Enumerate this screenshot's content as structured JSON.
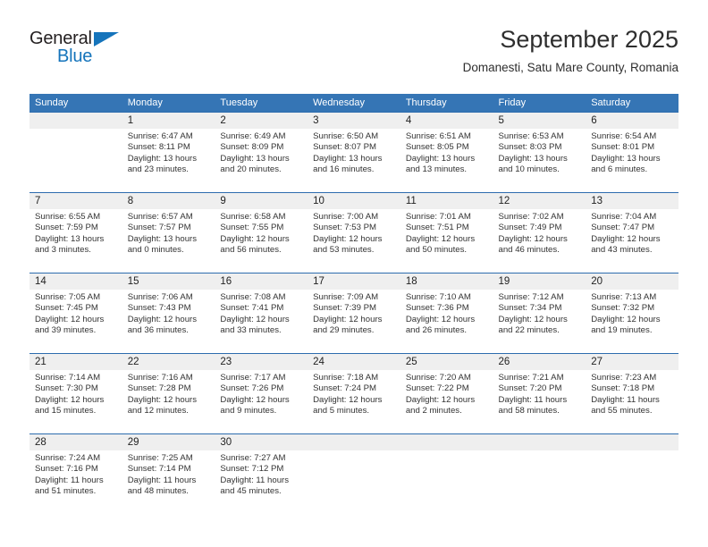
{
  "brand": {
    "name_part1": "General",
    "name_part2": "Blue",
    "color_dark": "#231f20",
    "color_blue": "#1574BB"
  },
  "header": {
    "title": "September 2025",
    "subtitle": "Domanesti, Satu Mare County, Romania"
  },
  "theme": {
    "header_blue": "#3575B5",
    "separator_blue": "#2D6CAE",
    "daynum_band": "#EFEFEF"
  },
  "weekdays": [
    "Sunday",
    "Monday",
    "Tuesday",
    "Wednesday",
    "Thursday",
    "Friday",
    "Saturday"
  ],
  "weeks": [
    [
      {
        "day": "",
        "sunrise": "",
        "sunset": "",
        "daylight_1": "",
        "daylight_2": ""
      },
      {
        "day": "1",
        "sunrise": "Sunrise: 6:47 AM",
        "sunset": "Sunset: 8:11 PM",
        "daylight_1": "Daylight: 13 hours",
        "daylight_2": "and 23 minutes."
      },
      {
        "day": "2",
        "sunrise": "Sunrise: 6:49 AM",
        "sunset": "Sunset: 8:09 PM",
        "daylight_1": "Daylight: 13 hours",
        "daylight_2": "and 20 minutes."
      },
      {
        "day": "3",
        "sunrise": "Sunrise: 6:50 AM",
        "sunset": "Sunset: 8:07 PM",
        "daylight_1": "Daylight: 13 hours",
        "daylight_2": "and 16 minutes."
      },
      {
        "day": "4",
        "sunrise": "Sunrise: 6:51 AM",
        "sunset": "Sunset: 8:05 PM",
        "daylight_1": "Daylight: 13 hours",
        "daylight_2": "and 13 minutes."
      },
      {
        "day": "5",
        "sunrise": "Sunrise: 6:53 AM",
        "sunset": "Sunset: 8:03 PM",
        "daylight_1": "Daylight: 13 hours",
        "daylight_2": "and 10 minutes."
      },
      {
        "day": "6",
        "sunrise": "Sunrise: 6:54 AM",
        "sunset": "Sunset: 8:01 PM",
        "daylight_1": "Daylight: 13 hours",
        "daylight_2": "and 6 minutes."
      }
    ],
    [
      {
        "day": "7",
        "sunrise": "Sunrise: 6:55 AM",
        "sunset": "Sunset: 7:59 PM",
        "daylight_1": "Daylight: 13 hours",
        "daylight_2": "and 3 minutes."
      },
      {
        "day": "8",
        "sunrise": "Sunrise: 6:57 AM",
        "sunset": "Sunset: 7:57 PM",
        "daylight_1": "Daylight: 13 hours",
        "daylight_2": "and 0 minutes."
      },
      {
        "day": "9",
        "sunrise": "Sunrise: 6:58 AM",
        "sunset": "Sunset: 7:55 PM",
        "daylight_1": "Daylight: 12 hours",
        "daylight_2": "and 56 minutes."
      },
      {
        "day": "10",
        "sunrise": "Sunrise: 7:00 AM",
        "sunset": "Sunset: 7:53 PM",
        "daylight_1": "Daylight: 12 hours",
        "daylight_2": "and 53 minutes."
      },
      {
        "day": "11",
        "sunrise": "Sunrise: 7:01 AM",
        "sunset": "Sunset: 7:51 PM",
        "daylight_1": "Daylight: 12 hours",
        "daylight_2": "and 50 minutes."
      },
      {
        "day": "12",
        "sunrise": "Sunrise: 7:02 AM",
        "sunset": "Sunset: 7:49 PM",
        "daylight_1": "Daylight: 12 hours",
        "daylight_2": "and 46 minutes."
      },
      {
        "day": "13",
        "sunrise": "Sunrise: 7:04 AM",
        "sunset": "Sunset: 7:47 PM",
        "daylight_1": "Daylight: 12 hours",
        "daylight_2": "and 43 minutes."
      }
    ],
    [
      {
        "day": "14",
        "sunrise": "Sunrise: 7:05 AM",
        "sunset": "Sunset: 7:45 PM",
        "daylight_1": "Daylight: 12 hours",
        "daylight_2": "and 39 minutes."
      },
      {
        "day": "15",
        "sunrise": "Sunrise: 7:06 AM",
        "sunset": "Sunset: 7:43 PM",
        "daylight_1": "Daylight: 12 hours",
        "daylight_2": "and 36 minutes."
      },
      {
        "day": "16",
        "sunrise": "Sunrise: 7:08 AM",
        "sunset": "Sunset: 7:41 PM",
        "daylight_1": "Daylight: 12 hours",
        "daylight_2": "and 33 minutes."
      },
      {
        "day": "17",
        "sunrise": "Sunrise: 7:09 AM",
        "sunset": "Sunset: 7:39 PM",
        "daylight_1": "Daylight: 12 hours",
        "daylight_2": "and 29 minutes."
      },
      {
        "day": "18",
        "sunrise": "Sunrise: 7:10 AM",
        "sunset": "Sunset: 7:36 PM",
        "daylight_1": "Daylight: 12 hours",
        "daylight_2": "and 26 minutes."
      },
      {
        "day": "19",
        "sunrise": "Sunrise: 7:12 AM",
        "sunset": "Sunset: 7:34 PM",
        "daylight_1": "Daylight: 12 hours",
        "daylight_2": "and 22 minutes."
      },
      {
        "day": "20",
        "sunrise": "Sunrise: 7:13 AM",
        "sunset": "Sunset: 7:32 PM",
        "daylight_1": "Daylight: 12 hours",
        "daylight_2": "and 19 minutes."
      }
    ],
    [
      {
        "day": "21",
        "sunrise": "Sunrise: 7:14 AM",
        "sunset": "Sunset: 7:30 PM",
        "daylight_1": "Daylight: 12 hours",
        "daylight_2": "and 15 minutes."
      },
      {
        "day": "22",
        "sunrise": "Sunrise: 7:16 AM",
        "sunset": "Sunset: 7:28 PM",
        "daylight_1": "Daylight: 12 hours",
        "daylight_2": "and 12 minutes."
      },
      {
        "day": "23",
        "sunrise": "Sunrise: 7:17 AM",
        "sunset": "Sunset: 7:26 PM",
        "daylight_1": "Daylight: 12 hours",
        "daylight_2": "and 9 minutes."
      },
      {
        "day": "24",
        "sunrise": "Sunrise: 7:18 AM",
        "sunset": "Sunset: 7:24 PM",
        "daylight_1": "Daylight: 12 hours",
        "daylight_2": "and 5 minutes."
      },
      {
        "day": "25",
        "sunrise": "Sunrise: 7:20 AM",
        "sunset": "Sunset: 7:22 PM",
        "daylight_1": "Daylight: 12 hours",
        "daylight_2": "and 2 minutes."
      },
      {
        "day": "26",
        "sunrise": "Sunrise: 7:21 AM",
        "sunset": "Sunset: 7:20 PM",
        "daylight_1": "Daylight: 11 hours",
        "daylight_2": "and 58 minutes."
      },
      {
        "day": "27",
        "sunrise": "Sunrise: 7:23 AM",
        "sunset": "Sunset: 7:18 PM",
        "daylight_1": "Daylight: 11 hours",
        "daylight_2": "and 55 minutes."
      }
    ],
    [
      {
        "day": "28",
        "sunrise": "Sunrise: 7:24 AM",
        "sunset": "Sunset: 7:16 PM",
        "daylight_1": "Daylight: 11 hours",
        "daylight_2": "and 51 minutes."
      },
      {
        "day": "29",
        "sunrise": "Sunrise: 7:25 AM",
        "sunset": "Sunset: 7:14 PM",
        "daylight_1": "Daylight: 11 hours",
        "daylight_2": "and 48 minutes."
      },
      {
        "day": "30",
        "sunrise": "Sunrise: 7:27 AM",
        "sunset": "Sunset: 7:12 PM",
        "daylight_1": "Daylight: 11 hours",
        "daylight_2": "and 45 minutes."
      },
      {
        "day": "",
        "sunrise": "",
        "sunset": "",
        "daylight_1": "",
        "daylight_2": ""
      },
      {
        "day": "",
        "sunrise": "",
        "sunset": "",
        "daylight_1": "",
        "daylight_2": ""
      },
      {
        "day": "",
        "sunrise": "",
        "sunset": "",
        "daylight_1": "",
        "daylight_2": ""
      },
      {
        "day": "",
        "sunrise": "",
        "sunset": "",
        "daylight_1": "",
        "daylight_2": ""
      }
    ]
  ]
}
